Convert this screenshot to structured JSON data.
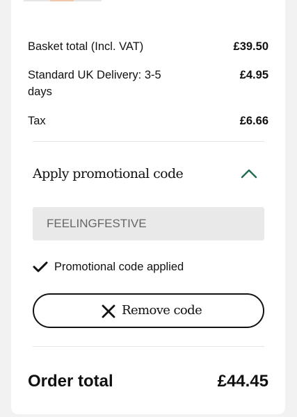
{
  "summary": {
    "rows": [
      {
        "label": "Basket total (Incl. VAT)",
        "value": "£39.50"
      },
      {
        "label": "Standard UK Delivery: 3-5 days",
        "value": "£4.95"
      },
      {
        "label": "Tax",
        "value": "£6.66"
      }
    ]
  },
  "promo": {
    "title": "Apply promotional code",
    "expanded": true,
    "code_value": "FEELINGFESTIVE",
    "applied_message": "Promotional code applied",
    "remove_label": "Remove code",
    "icons": {
      "toggle": "chevron-up-icon",
      "applied": "check-icon",
      "remove": "close-icon"
    },
    "accent_color": "#1f6b4e"
  },
  "order_total": {
    "label": "Order total",
    "value": "£44.45"
  }
}
